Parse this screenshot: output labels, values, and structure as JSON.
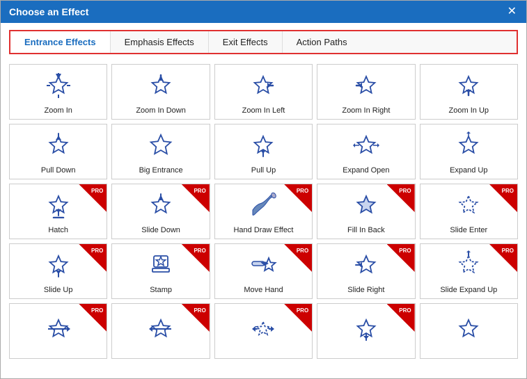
{
  "dialog": {
    "title": "Choose an Effect",
    "close_label": "✕"
  },
  "tabs": [
    {
      "id": "entrance",
      "label": "Entrance Effects",
      "active": true
    },
    {
      "id": "emphasis",
      "label": "Emphasis Effects",
      "active": false
    },
    {
      "id": "exit",
      "label": "Exit Effects",
      "active": false
    },
    {
      "id": "action",
      "label": "Action Paths",
      "active": false
    }
  ],
  "effects": [
    {
      "id": "zoom-in",
      "label": "Zoom In",
      "pro": false,
      "icon": "zoom-in"
    },
    {
      "id": "zoom-in-down",
      "label": "Zoom In Down",
      "pro": false,
      "icon": "zoom-in-down"
    },
    {
      "id": "zoom-in-left",
      "label": "Zoom In Left",
      "pro": false,
      "icon": "zoom-in-left"
    },
    {
      "id": "zoom-in-right",
      "label": "Zoom In Right",
      "pro": false,
      "icon": "zoom-in-right"
    },
    {
      "id": "zoom-in-up",
      "label": "Zoom In Up",
      "pro": false,
      "icon": "zoom-in-up"
    },
    {
      "id": "pull-down",
      "label": "Pull Down",
      "pro": false,
      "icon": "pull-down"
    },
    {
      "id": "big-entrance",
      "label": "Big Entrance",
      "pro": false,
      "icon": "big-entrance"
    },
    {
      "id": "pull-up",
      "label": "Pull Up",
      "pro": false,
      "icon": "pull-up"
    },
    {
      "id": "expand-open",
      "label": "Expand Open",
      "pro": false,
      "icon": "expand-open"
    },
    {
      "id": "expand-up",
      "label": "Expand Up",
      "pro": false,
      "icon": "expand-up"
    },
    {
      "id": "hatch",
      "label": "Hatch",
      "pro": true,
      "icon": "hatch"
    },
    {
      "id": "slide-down",
      "label": "Slide Down",
      "pro": true,
      "icon": "slide-down"
    },
    {
      "id": "hand-draw",
      "label": "Hand Draw Effect",
      "pro": true,
      "icon": "hand-draw"
    },
    {
      "id": "fill-in-back",
      "label": "Fill In Back",
      "pro": true,
      "icon": "fill-in-back"
    },
    {
      "id": "slide-enter",
      "label": "Slide Enter",
      "pro": true,
      "icon": "slide-enter"
    },
    {
      "id": "slide-up",
      "label": "Slide Up",
      "pro": true,
      "icon": "slide-up"
    },
    {
      "id": "stamp",
      "label": "Stamp",
      "pro": true,
      "icon": "stamp"
    },
    {
      "id": "move-hand",
      "label": "Move Hand",
      "pro": true,
      "icon": "move-hand"
    },
    {
      "id": "slide-right",
      "label": "Slide Right",
      "pro": true,
      "icon": "slide-right"
    },
    {
      "id": "slide-expand-up",
      "label": "Slide Expand Up",
      "pro": true,
      "icon": "slide-expand-up"
    },
    {
      "id": "row5-1",
      "label": "",
      "pro": true,
      "icon": "row5-1"
    },
    {
      "id": "row5-2",
      "label": "",
      "pro": true,
      "icon": "row5-2"
    },
    {
      "id": "row5-3",
      "label": "",
      "pro": true,
      "icon": "row5-3"
    },
    {
      "id": "row5-4",
      "label": "",
      "pro": true,
      "icon": "row5-4"
    },
    {
      "id": "row5-5",
      "label": "",
      "pro": false,
      "icon": "row5-5"
    }
  ],
  "colors": {
    "blue": "#1a6dbf",
    "red": "#cc0000",
    "star_stroke": "#2a4ea6",
    "star_fill": "none"
  }
}
